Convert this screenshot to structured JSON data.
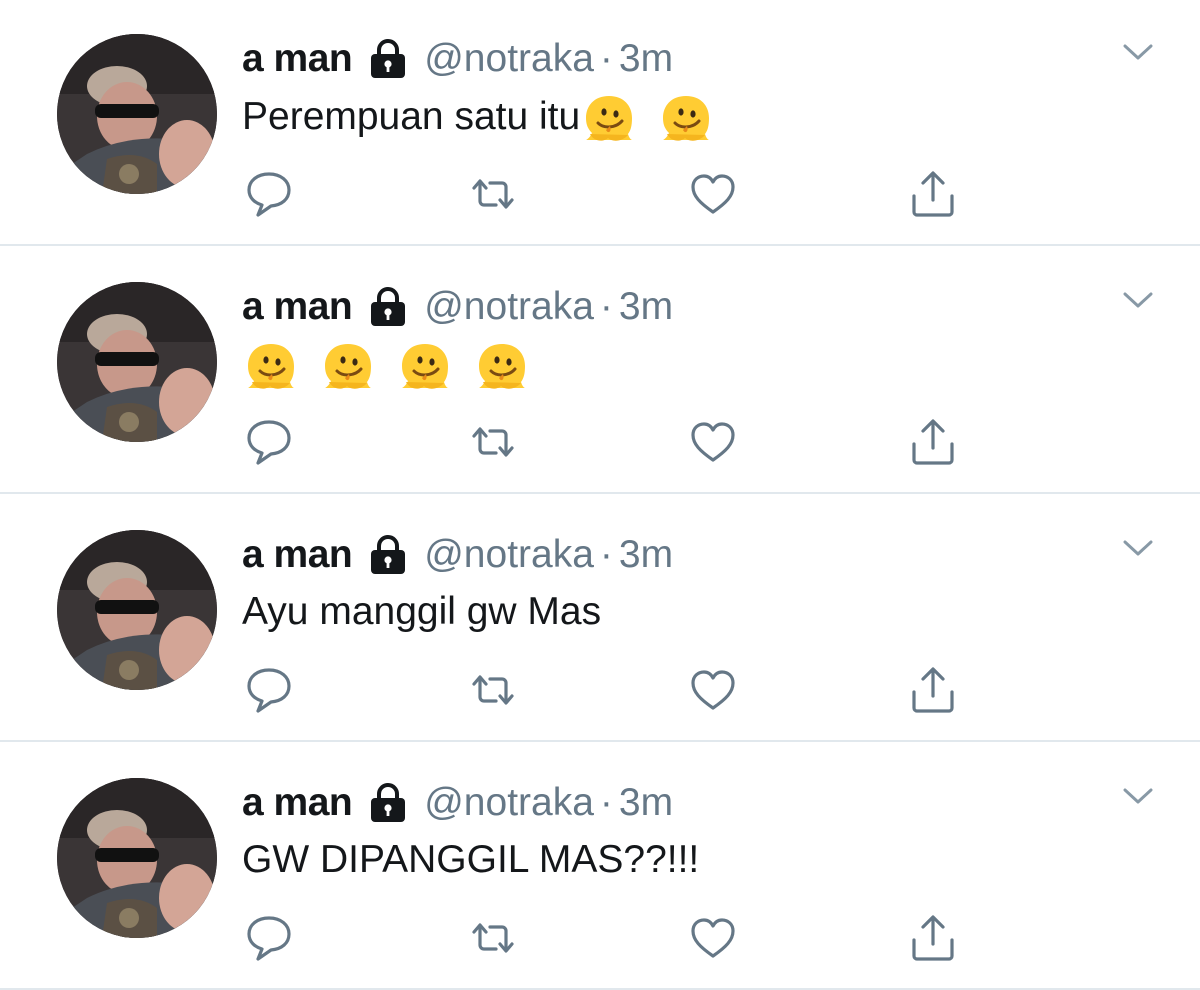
{
  "tweets": [
    {
      "author_name": "a man",
      "handle": "@notraka",
      "separator": "·",
      "time": "3m",
      "text": "Perempuan satu itu",
      "emoji_count": 2
    },
    {
      "author_name": "a man",
      "handle": "@notraka",
      "separator": "·",
      "time": "3m",
      "text": "",
      "emoji_count": 4
    },
    {
      "author_name": "a man",
      "handle": "@notraka",
      "separator": "·",
      "time": "3m",
      "text": "Ayu manggil gw Mas",
      "emoji_count": 0
    },
    {
      "author_name": "a man",
      "handle": "@notraka",
      "separator": "·",
      "time": "3m",
      "text": "GW DIPANGGIL MAS??!!!",
      "emoji_count": 0
    }
  ],
  "icons": {
    "protected": "lock-icon",
    "menu": "chevron-down-icon",
    "reply": "reply-icon",
    "retweet": "retweet-icon",
    "like": "heart-icon",
    "share": "share-icon",
    "emoji": "melting-face-emoji"
  },
  "colors": {
    "text": "#14171a",
    "secondary": "#657786",
    "divider": "#e1e8ed",
    "emoji": "#ffcc33"
  }
}
